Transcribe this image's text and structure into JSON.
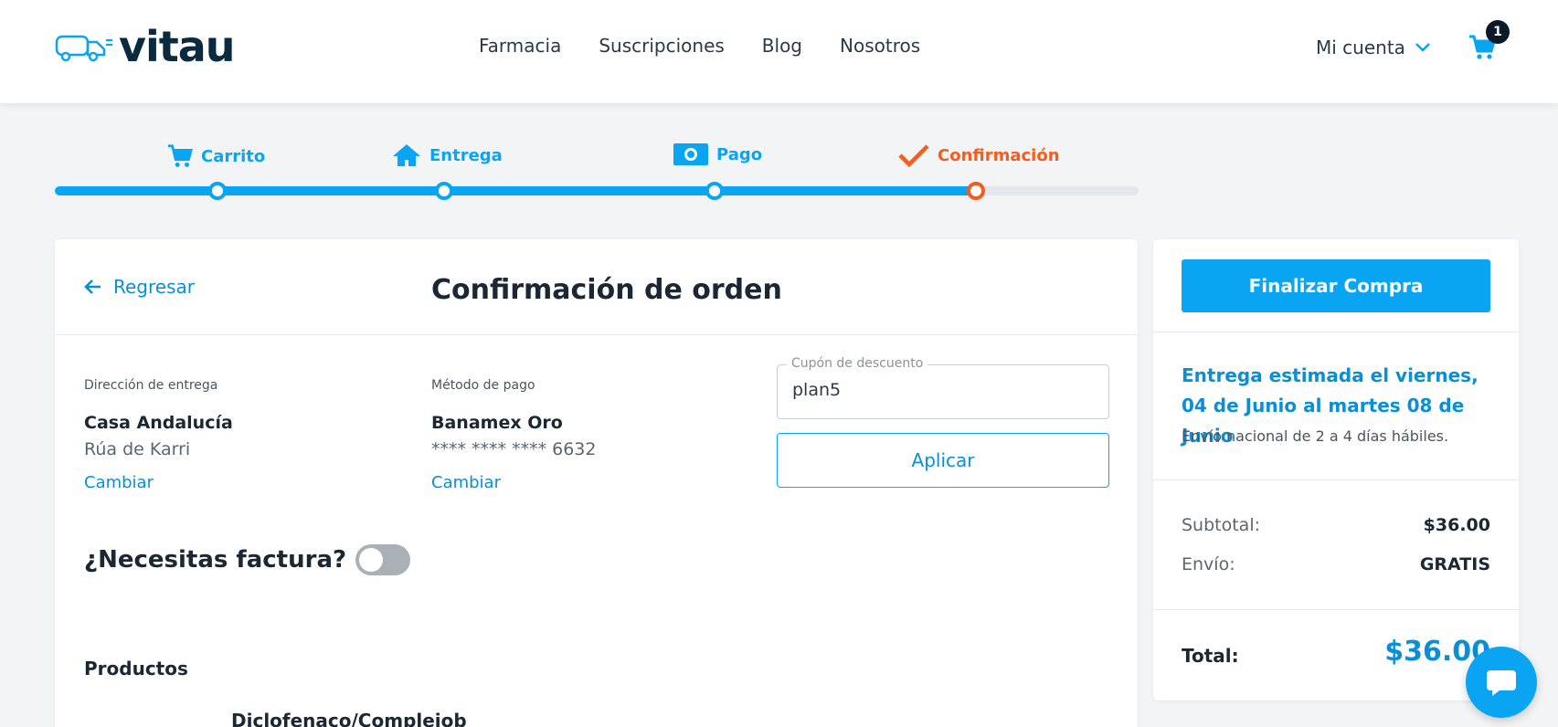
{
  "header": {
    "brand": "vitau",
    "nav": [
      "Farmacia",
      "Suscripciones",
      "Blog",
      "Nosotros"
    ],
    "account_label": "Mi cuenta",
    "cart_count": "1"
  },
  "steps": [
    {
      "label": "Carrito",
      "icon": "cart-icon"
    },
    {
      "label": "Entrega",
      "icon": "home-icon"
    },
    {
      "label": "Pago",
      "icon": "money-icon"
    },
    {
      "label": "Confirmación",
      "icon": "check-icon"
    }
  ],
  "order": {
    "back_label": "Regresar",
    "title": "Confirmación de orden",
    "delivery": {
      "label": "Dirección de entrega",
      "name": "Casa Andalucía",
      "address": "Rúa de Karri",
      "change": "Cambiar"
    },
    "payment": {
      "label": "Método de pago",
      "name": "Banamex Oro",
      "card": "**** **** **** 6632",
      "change": "Cambiar"
    },
    "coupon": {
      "label": "Cupón de descuento",
      "value": "plan5",
      "apply": "Aplicar"
    },
    "invoice_question": "¿Necesitas factura?",
    "invoice_enabled": false,
    "products_title": "Productos",
    "product_name": "Diclofenaco/Complejob"
  },
  "summary": {
    "finalize": "Finalizar Compra",
    "eta": "Entrega estimada el viernes, 04 de Junio al martes 08 de Junio",
    "eta_sub": "Envío nacional de 2 a 4 días hábiles.",
    "subtotal_label": "Subtotal:",
    "subtotal_value": "$36.00",
    "shipping_label": "Envío:",
    "shipping_value": "GRATIS",
    "total_label": "Total:",
    "total_value": "$36.00"
  },
  "colors": {
    "primary": "#0aa5f2",
    "accent": "#f45d1e",
    "dark": "#0b2a40"
  }
}
